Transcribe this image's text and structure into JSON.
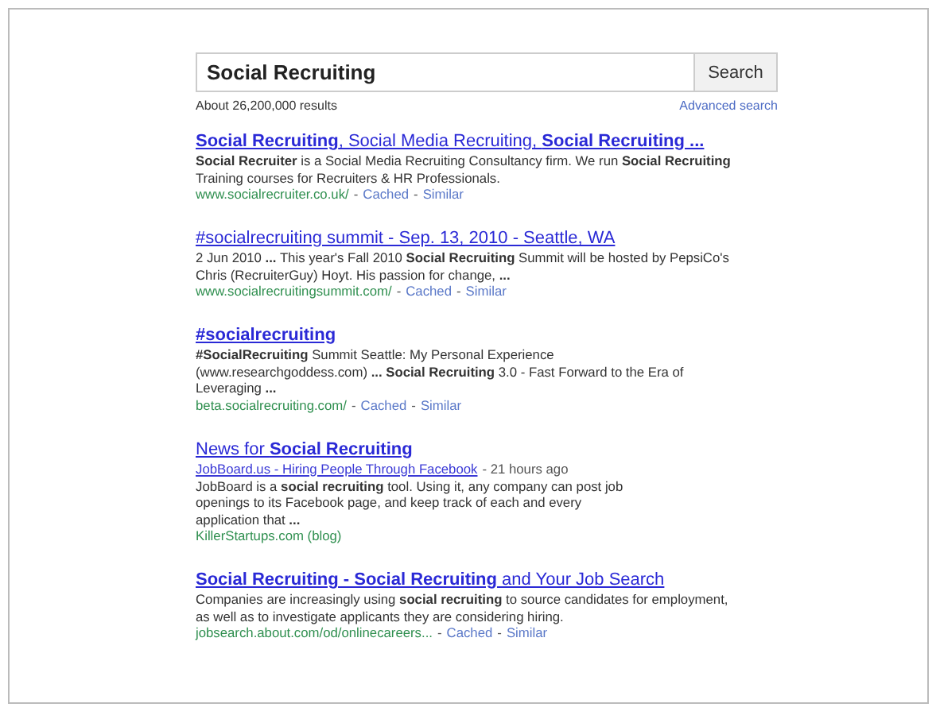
{
  "search": {
    "value": "Social Recruiting",
    "button": "Search"
  },
  "stats": "About 26,200,000 results",
  "advanced_link": "Advanced search",
  "results": [
    {
      "kind": "web",
      "title": "**Social Recruiting**, Social Media Recruiting, **Social Recruiting ...**",
      "snippet": [
        "**Social Recruiter** is a Social Media Recruiting Consultancy firm. We run **Social Recruiting**",
        "Training courses for Recruiters & HR Professionals."
      ],
      "url": "www.socialrecruiter.co.uk/",
      "sep": "-",
      "cached": "Cached",
      "similar": "Similar"
    },
    {
      "kind": "web",
      "title": "#socialrecruiting summit - Sep. 13, 2010 - Seattle, WA",
      "snippet": [
        "2 Jun 2010 **...** This year's Fall 2010 **Social Recruiting** Summit will be hosted by PepsiCo's",
        "Chris (RecruiterGuy) Hoyt. His passion for change, **...**"
      ],
      "url": "www.socialrecruitingsummit.com/",
      "sep": "-",
      "cached": "Cached",
      "similar": "Similar"
    },
    {
      "kind": "web",
      "title": "**#socialrecruiting**",
      "snippet": [
        "**#SocialRecruiting** Summit Seattle: My Personal Experience",
        "(www.researchgoddess.com) **...** **Social Recruiting** 3.0 - Fast Forward to the Era of",
        "Leveraging **...**"
      ],
      "url": "beta.socialrecruiting.com/",
      "sep": "-",
      "cached": "Cached",
      "similar": "Similar"
    },
    {
      "kind": "news",
      "title": "News for **Social Recruiting**",
      "headline": "JobBoard.us - Hiring People Through Facebook",
      "time": "- 21 hours ago",
      "snippet": [
        "JobBoard is a **social recruiting** tool. Using it, any company can post job",
        "openings to its Facebook page, and keep track of each and every",
        "application that **...**"
      ],
      "source": "KillerStartups.com (blog)"
    },
    {
      "kind": "web",
      "title": "**Social Recruiting - Social Recruiting** and Your Job Search",
      "snippet": [
        "Companies are increasingly using **social recruiting** to source candidates for employment,",
        "as well as to investigate applicants they are considering hiring."
      ],
      "url": "jobsearch.about.com/od/onlinecareers...",
      "sep": "-",
      "cached": "Cached",
      "similar": "Similar"
    }
  ]
}
